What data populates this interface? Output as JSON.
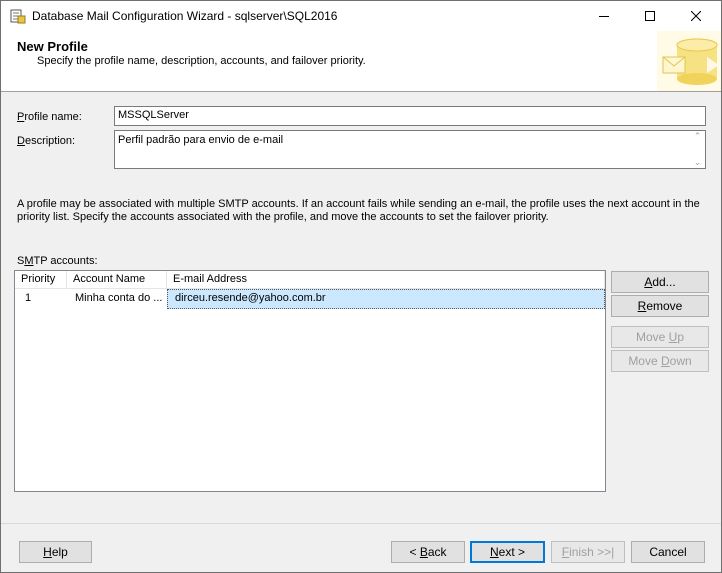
{
  "window": {
    "title": "Database Mail Configuration Wizard - sqlserver\\SQL2016",
    "icon": "database-mail-icon"
  },
  "header": {
    "title": "New Profile",
    "subtitle": "Specify the profile name, description, accounts, and failover priority."
  },
  "form": {
    "profile_name_label_mnemonic": "P",
    "profile_name_label_rest": "rofile name:",
    "profile_name_value": "MSSQLServer",
    "description_label_mnemonic": "D",
    "description_label_rest": "escription:",
    "description_value": "Perfil padrão para envio de e-mail"
  },
  "info_text": "A profile may be associated with multiple SMTP accounts. If an account fails while sending an e-mail, the profile uses the next account in the priority list. Specify the accounts associated with the profile, and move the accounts to set the failover priority.",
  "smtp": {
    "label_start": "S",
    "label_mnemonic": "M",
    "label_rest": "TP accounts:",
    "columns": [
      "Priority",
      "Account Name",
      "E-mail Address"
    ],
    "rows": [
      {
        "priority": "1",
        "account_name": "Minha conta do ...",
        "email": "dirceu.resende@yahoo.com.br"
      }
    ]
  },
  "side_buttons": {
    "add_mnemonic": "A",
    "add_rest": "dd...",
    "remove_mnemonic": "R",
    "remove_rest": "emove",
    "move_up_start": "Move ",
    "move_up_mnemonic": "U",
    "move_up_rest": "p",
    "move_down_start": "Move ",
    "move_down_mnemonic": "D",
    "move_down_rest": "own"
  },
  "footer_buttons": {
    "help_mnemonic": "H",
    "help_rest": "elp",
    "back_start": "< ",
    "back_mnemonic": "B",
    "back_rest": "ack",
    "next_mnemonic": "N",
    "next_rest": "ext >",
    "finish_mnemonic": "F",
    "finish_rest": "inish >>|",
    "cancel": "Cancel"
  },
  "colors": {
    "selection": "#cce8ff",
    "default_button_border": "#0078d7"
  }
}
